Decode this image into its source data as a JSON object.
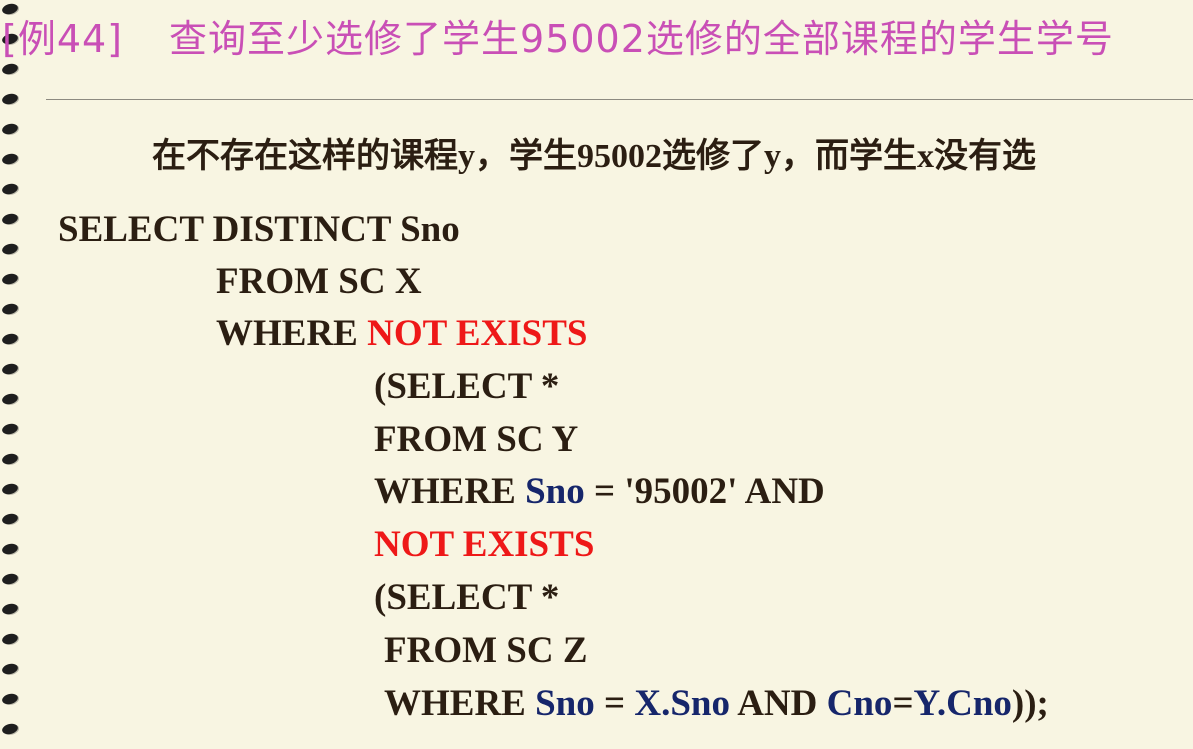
{
  "slide": {
    "title_example": "[例44]",
    "title_text": "查询至少选修了学生95002选修的全部课程的学生学号",
    "explanation": "在不存在这样的课程y，学生95002选修了y，而学生x没有选",
    "colors": {
      "background": "#F8F5E2",
      "title": "#C94FB6",
      "text": "#2B1E12",
      "keyword_red": "#EE1818",
      "identifier_blue": "#16266B"
    }
  },
  "code": {
    "line1": "SELECT DISTINCT Sno",
    "line2": "FROM SC X",
    "line3_a": "WHERE ",
    "line3_b": "NOT EXISTS",
    "line4": "(SELECT *",
    "line5": "FROM SC Y",
    "line6_a": "WHERE ",
    "line6_b": "Sno",
    "line6_c": " = '95002' AND",
    "line7": "NOT EXISTS",
    "line8": "(SELECT *",
    "line9": "FROM SC Z",
    "line10_a": "WHERE ",
    "line10_b": "Sno",
    "line10_c": " = ",
    "line10_d": "X.Sno",
    "line10_e": " AND ",
    "line10_f": "Cno",
    "line10_g": "=",
    "line10_h": "Y.Cno",
    "line10_i": "));"
  }
}
